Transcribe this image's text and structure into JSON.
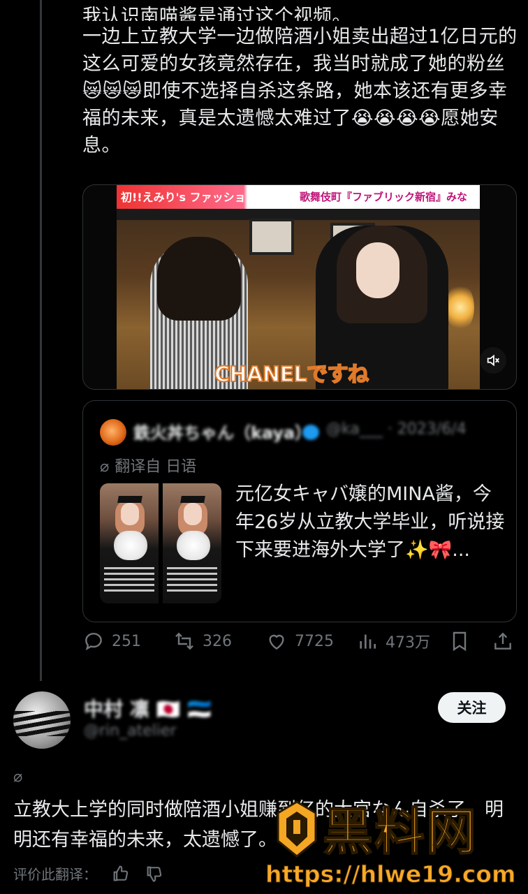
{
  "tweet": {
    "text_top": "我认识南喵酱是通过这个视频。",
    "text": "一边上立教大学一边做陪酒小姐卖出超过1亿日元的这么可爱的女孩竟然存在，我当时就成了她的粉丝😿😿😿即使不选择自杀这条路，她本该还有更多幸福的未来，真是太遗憾太难过了😭😭😭😭愿她安息。"
  },
  "video": {
    "banner_left": "初!!えみり's ファッションチェック",
    "banner_right": "歌舞伎町『ファブリック新宿』みな",
    "caption": "CHANELですね",
    "mute_icon": "speaker-muted-icon"
  },
  "quote": {
    "name": "鉄火丼ちゃん（kaya）",
    "handle": "@ka___ · 2023/6/4",
    "translated_label": "翻译自 日语",
    "text": "元亿女キャバ嬢的MINA酱，今年26岁从立教大学毕业，听说接下来要进海外大学了✨🎀..."
  },
  "actions": {
    "replies": "251",
    "reposts": "326",
    "likes": "7725",
    "views": "473万"
  },
  "reply": {
    "name": "中村 凛 🇯🇵 🇪🇪",
    "handle": "@rin_atelier",
    "follow_label": "关注",
    "text": "立教大上学的同时做陪酒小姐赚到亿的大宫なん自杀了，明明还有幸福的未来，太遗憾了。",
    "rate_label": "评价此翻译："
  },
  "watermark": {
    "title": "黑料网",
    "url": "https://hlwe19.com"
  },
  "colors": {
    "background": "#000000",
    "text": "#e7e9ea",
    "muted": "#71767b",
    "border": "#2f3336",
    "watermark": "#f5a623"
  }
}
